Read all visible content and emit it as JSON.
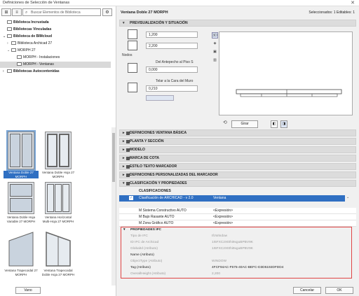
{
  "window": {
    "title": "Definiciones de Selección de Ventanas",
    "close": "✕"
  },
  "toolbar": {
    "search_placeholder": "Buscar Elementos de Biblioteca"
  },
  "tree": [
    {
      "label": "Biblioteca Incrustada",
      "bold": true
    },
    {
      "label": "Bibliotecas Vinculadas",
      "bold": true
    },
    {
      "label": "Biblioteca de BIMcloud",
      "bold": true
    },
    {
      "label": "Biblioteca Archicad 27",
      "bold": false
    },
    {
      "label": "MORPH 27",
      "bold": false
    },
    {
      "label": "MORPH - Instalaciones",
      "bold": false
    },
    {
      "label": "MORPH - Ventanas",
      "bold": false
    },
    {
      "label": "Bibliotecas Autocontenidas",
      "bold": true
    }
  ],
  "thumbs": [
    {
      "label": "Ventana Doble 27 MORPH"
    },
    {
      "label": "Ventana Doble Hoja 27 MORPH"
    },
    {
      "label": "Ventana Doble Hoja Variable 27 MORPH"
    },
    {
      "label": "Ventana Horizontal Multi-Hoja 27 MORPH"
    },
    {
      "label": "Ventana Trapecoidal 27 MORPH"
    },
    {
      "label": "Ventana Trapecoidal Doble Hoja 27 MORPH"
    }
  ],
  "vano_label": "Vano",
  "header": {
    "title": "Ventana Doble 27 MORPH",
    "selected": "Seleccionados: 1 Editables: 1"
  },
  "sections": {
    "preview": "PREVISUALIZACIÓN Y SITUACIÓN",
    "s1": "DEFINICIONES VENTANA BÁSICA",
    "s2": "PLANTA Y SECCIÓN",
    "s3": "MODELO",
    "s4": "MARCA DE COTA",
    "s5": "ESTILO TEXTO MARCADOR",
    "s6": "DEFINICIONES PERSONALIZADAS DEL MARCADOR",
    "s7": "CLASIFICACIÓN Y PROPIEDADES"
  },
  "geo": {
    "width": "1,200",
    "height": "2,200",
    "nodos_label": "Nodos",
    "sill_label": "Del Antepecho al Piso S",
    "sill_value": "0,000",
    "reveal_label": "Telar a la Cara del Muro",
    "reveal_value": "0,210",
    "view3d": "3D",
    "girar": "Girar"
  },
  "class": {
    "label": "CLASIFICACIONES",
    "row_name": "Clasificación de ARCHICAD - v 2.0",
    "row_value": "Ventana"
  },
  "props": [
    {
      "name": "M Sistema Constructivo AUTO",
      "value": "<Expresión>",
      "dim": false
    },
    {
      "name": "M Bajo Rasante AUTO",
      "value": "<Expresión>",
      "dim": false
    },
    {
      "name": "M Zona Gráfico AUTO",
      "value": "<Expresión>",
      "dim": false
    }
  ],
  "ifc": {
    "header": "PROPIEDADES IFC",
    "rows": [
      {
        "name": "Tipo de IFC",
        "value": "IfcWindow",
        "dim": true
      },
      {
        "name": "ID IFC de Archicad",
        "value": "1I5FXC2Xt0hi9xguBPBV9K",
        "dim": true
      },
      {
        "name": "GlobalId (Atributo)",
        "value": "1I5FXC2Xt0hi9xguBPBV9K",
        "dim": true
      },
      {
        "name": "Name (Atributo)",
        "value": "",
        "dim": false
      },
      {
        "name": "ObjectType (Atributo)",
        "value": "WINDOW",
        "dim": true
      },
      {
        "name": "Tag (Atributo)",
        "value": "4FCF94AC-F575-40AC-BEFC-D3D5192DFDD4",
        "dim": false
      },
      {
        "name": "OverallHeight (Atributo)",
        "value": "2,200",
        "dim": true
      }
    ]
  },
  "buttons": {
    "cancel": "Cancelar",
    "ok": "OK"
  }
}
